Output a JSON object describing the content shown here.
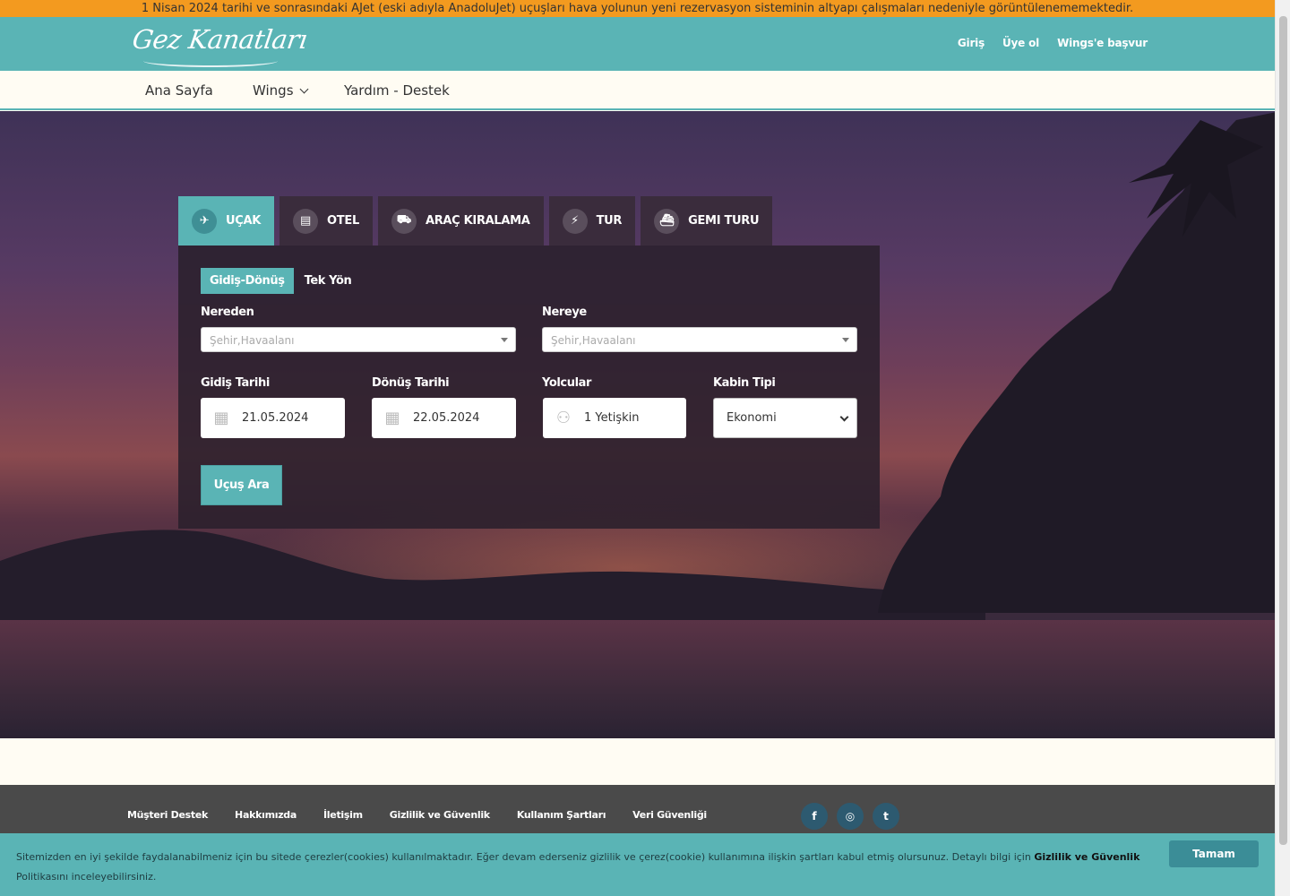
{
  "announcement": "1 Nisan 2024 tarihi ve sonrasındaki AJet (eski adıyla AnadoluJet) uçuşları hava yolunun yeni rezervasyon sisteminin altyapı çalışmaları nedeniyle görüntülenememektedir.",
  "header": {
    "logo": "Gez Kanatları",
    "links": [
      "Giriş",
      "Üye ol",
      "Wings'e başvur"
    ]
  },
  "nav": {
    "home": "Ana Sayfa",
    "wings": "Wings",
    "help": "Yardım - Destek"
  },
  "tabs": [
    {
      "label": "UÇAK",
      "icon": "plane-icon",
      "glyph": "✈"
    },
    {
      "label": "OTEL",
      "icon": "building-icon",
      "glyph": "▤"
    },
    {
      "label": "ARAÇ KIRALAMA",
      "icon": "car-icon",
      "glyph": "⛟"
    },
    {
      "label": "TUR",
      "icon": "bolt-icon",
      "glyph": "⚡"
    },
    {
      "label": "GEMI TURU",
      "icon": "ship-icon",
      "glyph": "⛴"
    }
  ],
  "search": {
    "trip_round": "Gidiş-Dönüş",
    "trip_oneway": "Tek Yön",
    "from_label": "Nereden",
    "from_placeholder": "Şehir,Havaalanı",
    "to_label": "Nereye",
    "to_placeholder": "Şehir,Havaalanı",
    "depart_label": "Gidiş Tarihi",
    "depart_value": "21.05.2024",
    "return_label": "Dönüş Tarihi",
    "return_value": "22.05.2024",
    "passengers_label": "Yolcular",
    "passengers_value": "1 Yetişkin",
    "cabin_label": "Kabin Tipi",
    "cabin_value": "Ekonomi",
    "submit": "Uçuş Ara"
  },
  "footer": {
    "links": [
      "Müşteri Destek",
      "Hakkımızda",
      "İletişim",
      "Gizlilik ve Güvenlik",
      "Kullanım Şartları",
      "Veri Güvenliği"
    ],
    "social": [
      {
        "name": "facebook-icon",
        "glyph": "f"
      },
      {
        "name": "instagram-icon",
        "glyph": "◎"
      },
      {
        "name": "twitter-icon",
        "glyph": "t"
      }
    ]
  },
  "cookie": {
    "text": "Sitemizden en iyi şekilde faydalanabilmeniz için bu sitede çerezler(cookies) kullanılmaktadır. Eğer devam ederseniz gizlilik ve çerez(cookie) kullanımına ilişkin şartları kabul etmiş olursunuz. Detaylı bilgi için",
    "link": "Gizlilik ve Güvenlik",
    "suffix": "Politikasını inceleyebilirsiniz.",
    "button": "Tamam"
  },
  "colors": {
    "accent": "#5ab4b5",
    "announcement": "#f39a1f",
    "footer": "#4a4a4a"
  }
}
